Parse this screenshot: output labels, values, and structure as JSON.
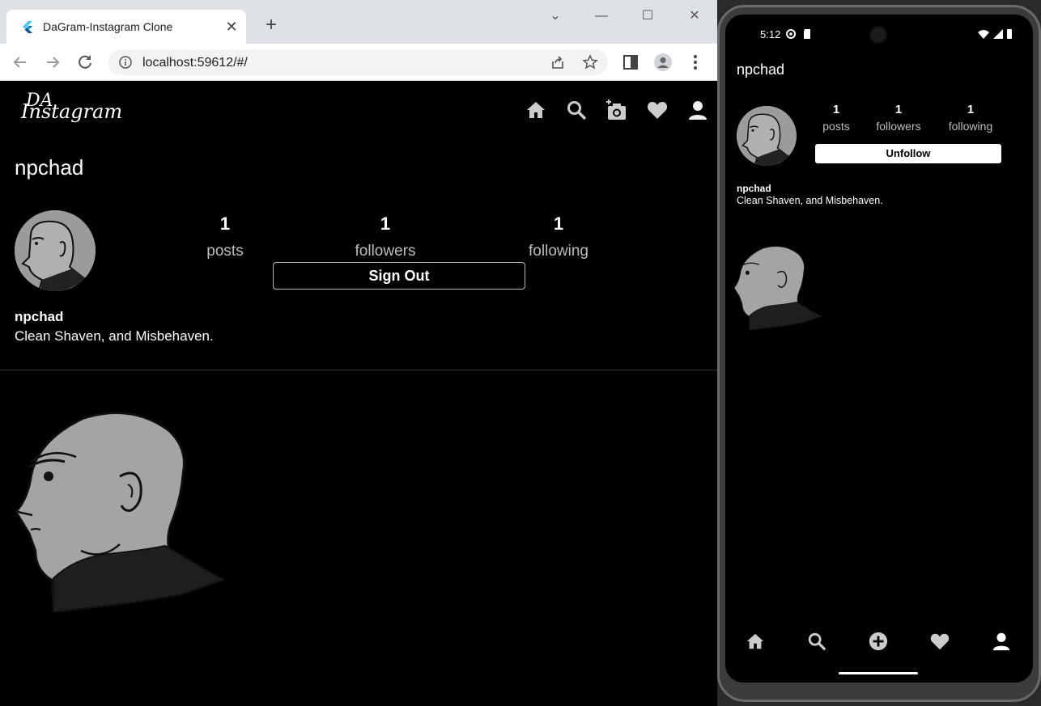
{
  "browser": {
    "tab_title": "DaGram-Instagram Clone",
    "tab_close": "✕",
    "new_tab": "+",
    "url": "localhost:59612/#/",
    "window_minimize": "—",
    "window_maximize": "☐",
    "window_close": "✕",
    "window_collapse": "⌄"
  },
  "app": {
    "logo_text": "Instagram",
    "logo_overlay": "DA",
    "nav_icons": [
      "home-icon",
      "search-icon",
      "add-photo-icon",
      "heart-icon",
      "person-icon"
    ],
    "profile_username": "npchad",
    "stats": [
      {
        "value": "1",
        "label": "posts"
      },
      {
        "value": "1",
        "label": "followers"
      },
      {
        "value": "1",
        "label": "following"
      }
    ],
    "signout_label": "Sign Out",
    "bio_name": "npchad",
    "bio_text": "Clean Shaven, and Misbehaven."
  },
  "phone": {
    "status_time": "5:12",
    "title": "npchad",
    "stats": [
      {
        "value": "1",
        "label": "posts"
      },
      {
        "value": "1",
        "label": "followers"
      },
      {
        "value": "1",
        "label": "following"
      }
    ],
    "unfollow_label": "Unfollow",
    "bio_name": "npchad",
    "bio_text": "Clean Shaven, and Misbehaven.",
    "nav_icons": [
      "home-icon",
      "search-icon",
      "add-circle-icon",
      "heart-icon",
      "person-icon"
    ]
  },
  "colors": {
    "background": "#000000",
    "text": "#ffffff",
    "muted": "#bdbdbd",
    "avatar_gray": "#9b9b9b"
  }
}
